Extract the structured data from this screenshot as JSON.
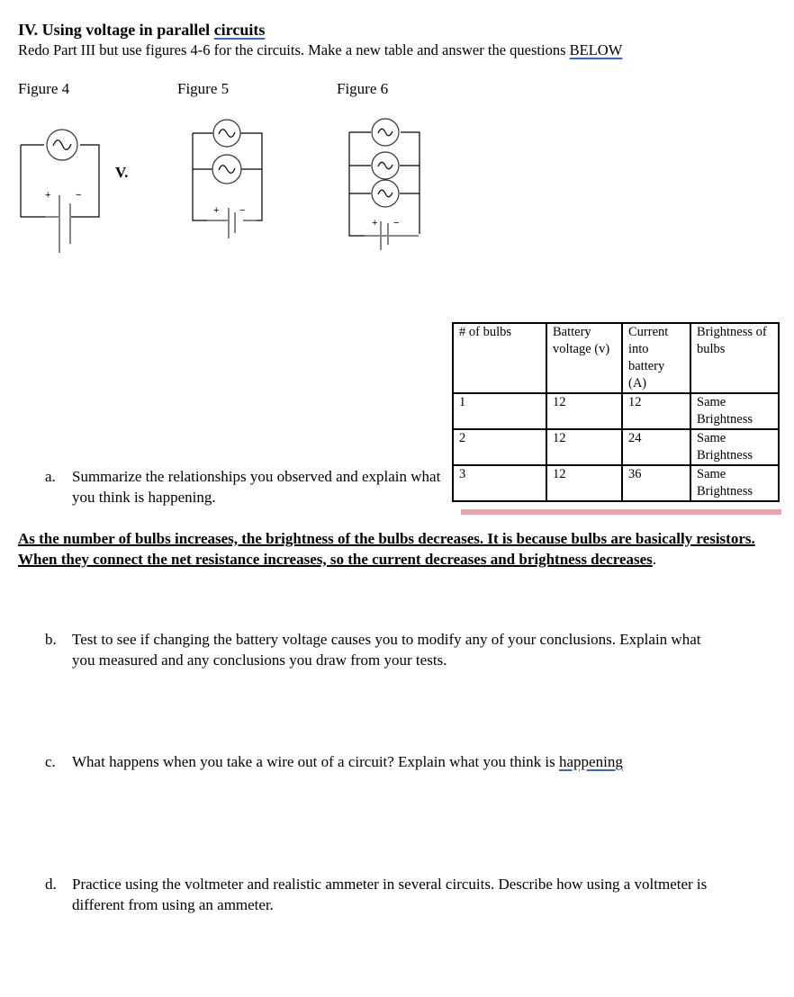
{
  "document": {
    "heading_prefix": "IV. Using voltage in parallel ",
    "heading_spellword": "circuits",
    "intro_prefix": "Redo Part III but use figures 4-6 for the circuits. Make a new table and answer the questions ",
    "intro_spellword": "BELOW",
    "figures": [
      {
        "label": "Figure 4",
        "bulbs": 1
      },
      {
        "label": "Figure 5",
        "bulbs": 2
      },
      {
        "label": "Figure 6",
        "bulbs": 3
      }
    ],
    "stray_label": "V.",
    "battery_plus": "+",
    "battery_minus": "−",
    "table": {
      "headers": [
        "# of bulbs",
        "Battery voltage (v)",
        "Current into battery (A)",
        "Brightness of bulbs"
      ],
      "rows": [
        [
          "1",
          "12",
          "12",
          "Same Brightness"
        ],
        [
          "2",
          "12",
          "24",
          "Same Brightness"
        ],
        [
          "3",
          "12",
          "36",
          "Same Brightness"
        ]
      ]
    },
    "questions": {
      "a": {
        "letter": "a.",
        "text": "Summarize the relationships you observed and explain what you think is happening."
      },
      "b": {
        "letter": "b.",
        "text": "Test to see if changing the battery voltage causes you to modify any of your conclusions. Explain what you measured and any conclusions you draw from your tests."
      },
      "c": {
        "letter": "c.",
        "text_prefix": "What happens when you take a wire out of a circuit? Explain what you think is ",
        "spellword": "happening"
      },
      "d": {
        "letter": "d.",
        "text": "Practice using the voltmeter and realistic ammeter in several circuits.  Describe how using a voltmeter is different from using an ammeter."
      }
    },
    "answer_a": {
      "text": "As the number of bulbs increases, the brightness of the bulbs decreases. It is because bulbs are basically resistors. When they connect the net resistance increases, so the current decreases and brightness decreases",
      "trailing": "."
    },
    "colors": {
      "spellcheck_underline": "#3b63c9",
      "highlight_bar": "#eba2ab"
    }
  }
}
